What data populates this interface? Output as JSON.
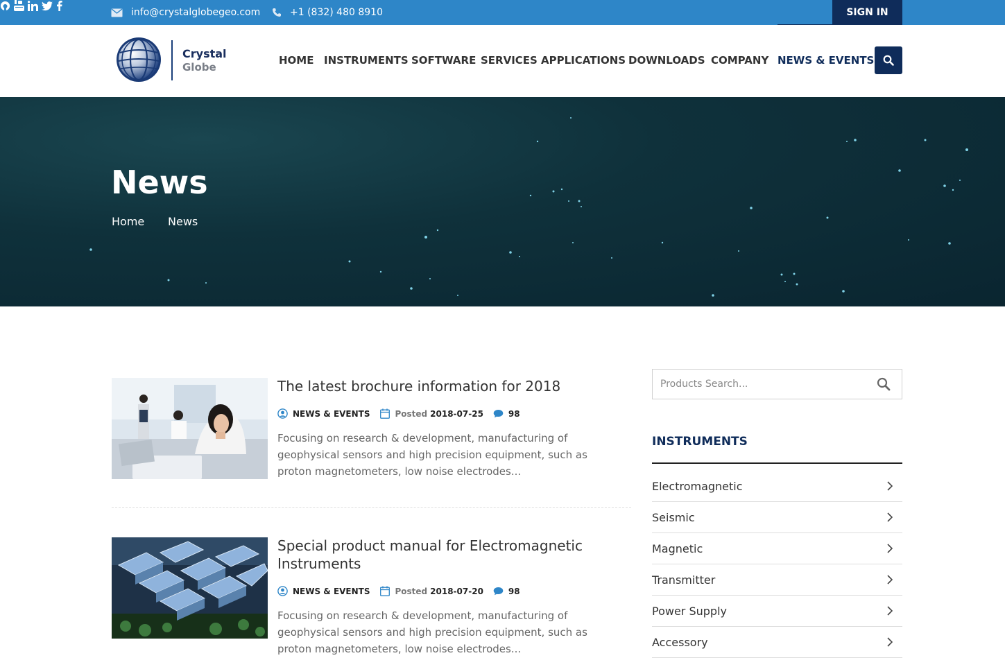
{
  "topbar": {
    "email": "info@crystalglobegeo.com",
    "phone": "+1 (832) 480 8910",
    "social_icons": [
      "github-icon",
      "youtube-icon",
      "linkedin-icon",
      "twitter-icon",
      "facebook-icon"
    ],
    "signin_label": "SIGN IN"
  },
  "brand": {
    "name_line1": "Crystal",
    "name_line2": "Globe"
  },
  "nav": {
    "items": [
      {
        "label": "HOME"
      },
      {
        "label": "INSTRUMENTS"
      },
      {
        "label": "SOFTWARE"
      },
      {
        "label": "SERVICES"
      },
      {
        "label": "APPLICATIONS"
      },
      {
        "label": "DOWNLOADS"
      },
      {
        "label": "COMPANY"
      },
      {
        "label": "NEWS & EVENTS"
      }
    ],
    "active": "NEWS & EVENTS"
  },
  "hero": {
    "title": "News",
    "breadcrumb": [
      "Home",
      "News"
    ]
  },
  "posts": [
    {
      "title": "The latest brochure information for 2018",
      "category": "NEWS & EVENTS",
      "posted_label": "Posted",
      "date": "2018-07-25",
      "comments": "98",
      "excerpt": "Focusing on research & development, manufacturing of geophysical sensors and high precision equipment, such as proton magnetometers, low noise electrodes..."
    },
    {
      "title": "Special product manual for Electromagnetic Instruments",
      "category": "NEWS & EVENTS",
      "posted_label": "Posted",
      "date": "2018-07-20",
      "comments": "98",
      "excerpt": "Focusing on research & development, manufacturing of geophysical sensors and high precision equipment, such as proton magnetometers, low noise electrodes..."
    }
  ],
  "sidebar": {
    "search_placeholder": "Products Search...",
    "heading": "INSTRUMENTS",
    "categories": [
      {
        "label": "Electromagnetic"
      },
      {
        "label": "Seismic"
      },
      {
        "label": "Magnetic"
      },
      {
        "label": "Transmitter"
      },
      {
        "label": "Power Supply"
      },
      {
        "label": "Accessory"
      }
    ]
  },
  "colors": {
    "topbar": "#2e86c8",
    "navy": "#0f2c5a",
    "hero": "#0f313b"
  }
}
